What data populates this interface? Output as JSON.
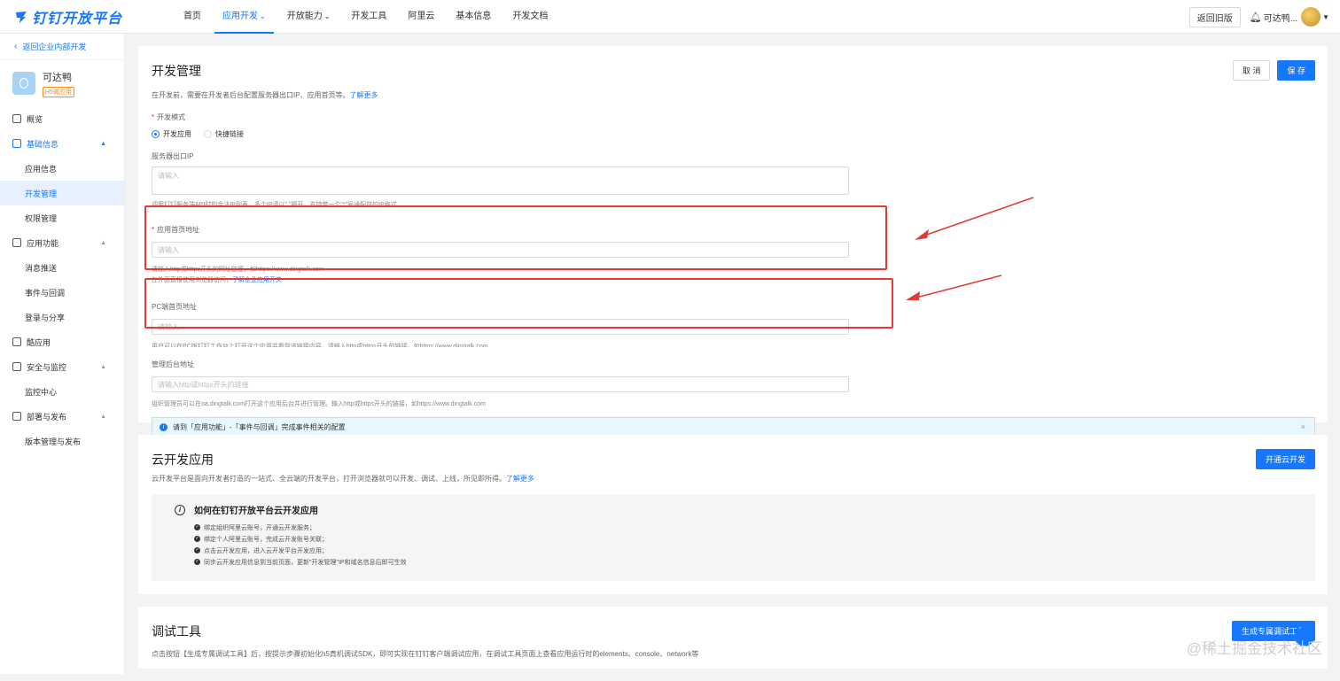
{
  "header": {
    "logo_text": "钉钉开放平台",
    "nav": [
      {
        "label": "首页",
        "active": false,
        "caret": false
      },
      {
        "label": "应用开发",
        "active": true,
        "caret": true
      },
      {
        "label": "开放能力",
        "active": false,
        "caret": true
      },
      {
        "label": "开发工具",
        "active": false,
        "caret": false
      },
      {
        "label": "阿里云",
        "active": false,
        "caret": false
      },
      {
        "label": "基本信息",
        "active": false,
        "caret": false
      },
      {
        "label": "开发文档",
        "active": false,
        "caret": false
      }
    ],
    "back_old_label": "返回旧版",
    "user_name": "可达鸭..."
  },
  "sidebar": {
    "back_label": "返回企业内部开发",
    "app_name": "可达鸭",
    "app_badge": "H5微应用",
    "items": [
      {
        "type": "group",
        "label": "概览",
        "active": false,
        "arrow": ""
      },
      {
        "type": "group",
        "label": "基础信息",
        "active": true,
        "arrow": "▲"
      },
      {
        "type": "sub",
        "label": "应用信息",
        "active": false
      },
      {
        "type": "sub",
        "label": "开发管理",
        "active": true
      },
      {
        "type": "sub",
        "label": "权限管理",
        "active": false
      },
      {
        "type": "group",
        "label": "应用功能",
        "active": false,
        "arrow": "▲"
      },
      {
        "type": "sub",
        "label": "消息推送",
        "active": false
      },
      {
        "type": "sub",
        "label": "事件与回调",
        "active": false
      },
      {
        "type": "sub",
        "label": "登录与分享",
        "active": false
      },
      {
        "type": "group",
        "label": "酷应用",
        "active": false,
        "arrow": ""
      },
      {
        "type": "group",
        "label": "安全与监控",
        "active": false,
        "arrow": "▲"
      },
      {
        "type": "sub",
        "label": "监控中心",
        "active": false
      },
      {
        "type": "group",
        "label": "部署与发布",
        "active": false,
        "arrow": "▲"
      },
      {
        "type": "sub",
        "label": "版本管理与发布",
        "active": false
      }
    ]
  },
  "dev": {
    "title": "开发管理",
    "desc": "在开发前，需要在开发者后台配置服务器出口IP、应用首页等。",
    "learn_more": "了解更多",
    "cancel_label": "取 消",
    "save_label": "保 存",
    "mode_label": "开发模式",
    "mode_options": [
      "开发应用",
      "快捷链接"
    ],
    "ip_label": "服务器出口IP",
    "ip_placeholder": "请输入",
    "ip_help": "调用钉钉服务端API时的合法IP列表，多个IP请以\",\"隔开，支持带一个\"*\"号通配符的IP格式",
    "home_label": "应用首页地址",
    "home_placeholder": "请输入",
    "home_help1": "请输入http或https开头的网址链接，如https://www.dingtalk.com",
    "home_help2": "在外面直接使用浏览器访问，",
    "home_help2_link": "了解企业应用开关",
    "pc_label": "PC端首页地址",
    "pc_placeholder": "请输入",
    "pc_help": "用户可以在PC版钉钉工作台上打开这个应用并看到该链接内容，请输入http或https开头的链接，如https://www.dingtalk.com",
    "admin_label": "管理后台地址",
    "admin_placeholder": "请输入http或https开头的链接",
    "admin_help": "组织管理员可以在oa.dingtalk.com打开这个应用后台并进行管理。输入http或https开头的链接，如https://www.dingtalk.com",
    "alert_text": "请到「应用功能」-「事件与回调」完成事件相关的配置",
    "alert_close": "×"
  },
  "cloud": {
    "title": "云开发应用",
    "desc": "云开发平台是面向开发者打造的一站式、全云端的开发平台，打开浏览器就可以开发、调试、上线，所见即所得。",
    "learn_more": "了解更多",
    "button_label": "开通云开发",
    "howto_title": "如何在钉钉开放平台云开发应用",
    "steps": [
      "绑定组织阿里云账号，开通云开发服务；",
      "绑定个人阿里云账号，完成云开发账号关联；",
      "点击云开发应用，进入云开发平台开发应用；",
      "同步云开发应用信息到当前页面，更新\"开发管理\"IP和域名信息后即可生效"
    ]
  },
  "debug": {
    "title": "调试工具",
    "desc": "点击按钮【生成专属调试工具】后，按提示步骤初始化h5真机调试SDK，即可实现在钉钉客户端调试应用，在调试工具页面上查看应用运行时的elements、console、network等",
    "button_label": "生成专属调试工具"
  },
  "watermark": "@稀土掘金技术社区"
}
